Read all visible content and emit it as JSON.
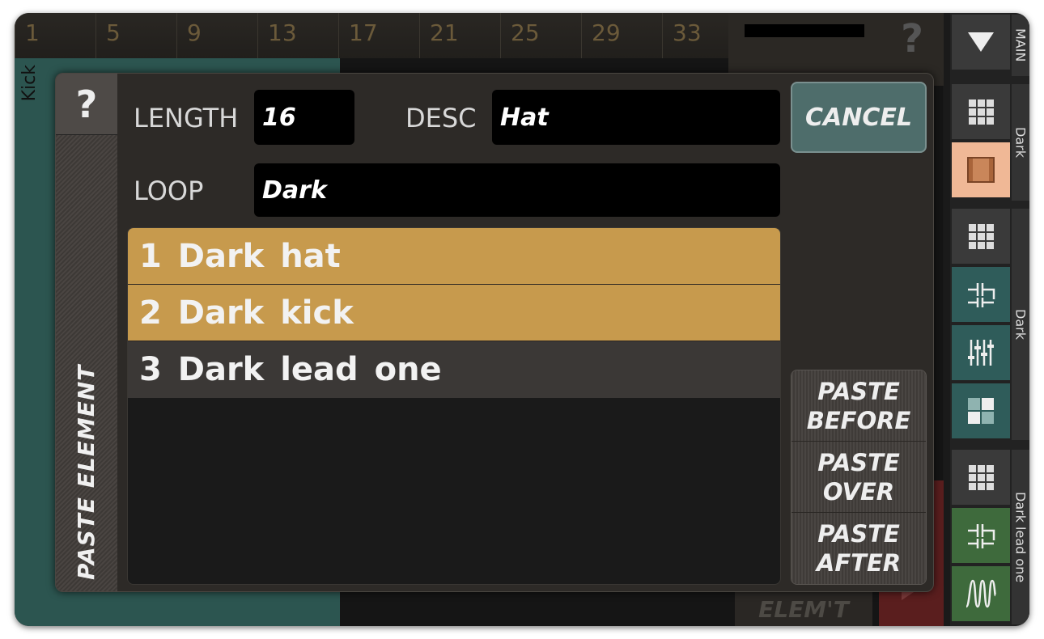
{
  "background": {
    "ruler_ticks": [
      "1",
      "5",
      "9",
      "13",
      "17",
      "21",
      "25",
      "29",
      "33"
    ],
    "track_label": "Kick",
    "help_glyph": "?",
    "delete_label": "DELETE ELEM'T"
  },
  "sidebar": {
    "section_labels": [
      "MAIN",
      "Dark",
      "Dark",
      "Dark lead one"
    ],
    "buttons": [
      {
        "icon": "triangle-down-icon",
        "bg": "#3a3a3a"
      },
      {
        "icon": "grid-icon",
        "bg": "#3a3a3a"
      },
      {
        "icon": "pattern-icon",
        "bg": "#f0b896"
      },
      {
        "icon": "grid-icon",
        "bg": "#3a3a3a"
      },
      {
        "icon": "connector-icon",
        "bg": "#2f5c5a"
      },
      {
        "icon": "mixer-icon",
        "bg": "#2f5c5a"
      },
      {
        "icon": "blocks-icon",
        "bg": "#2f5c5a"
      },
      {
        "icon": "grid-icon",
        "bg": "#3a3a3a"
      },
      {
        "icon": "connector-icon",
        "bg": "#3e6a3c"
      },
      {
        "icon": "waveform-icon",
        "bg": "#3e6a3c"
      }
    ]
  },
  "modal": {
    "title": "PASTE ELEMENT",
    "help": "?",
    "length_label": "LENGTH",
    "length_value": "16",
    "desc_label": "DESC",
    "desc_value": "Hat",
    "loop_label": "LOOP",
    "loop_value": "Dark",
    "cancel": "CANCEL",
    "items": [
      {
        "label": "1 Dark hat",
        "selected": true
      },
      {
        "label": "2 Dark kick",
        "selected": true
      },
      {
        "label": "3 Dark lead one",
        "selected": false
      }
    ],
    "paste_before": "PASTE BEFORE",
    "paste_over": "PASTE OVER",
    "paste_after": "PASTE AFTER"
  },
  "colors": {
    "selected_row": "#c79a4d",
    "cancel_bg": "#4e6d6b",
    "track_teal": "#2c5550"
  }
}
